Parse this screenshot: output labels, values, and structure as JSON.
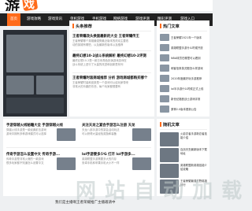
{
  "logo": {
    "text": "游",
    "badge": "戏"
  },
  "nav": [
    {
      "label": "首页",
      "active": true
    },
    {
      "label": "游戏攻略"
    },
    {
      "label": "游戏资讯"
    },
    {
      "label": "单机游戏"
    },
    {
      "label": "手机游戏"
    },
    {
      "label": "网络游戏"
    },
    {
      "label": "游戏评测"
    },
    {
      "label": "精彩评测"
    },
    {
      "label": "游戏入口"
    }
  ],
  "headlines": {
    "title": "头条推荐",
    "articles": [
      {
        "title": "王者荣耀改头换面最新的大全 王者荣耀传王",
        "summary": "王者荣耀哪个英雄最强势最近版本的改动主要改",
        "summary2": "动的英雄有哪些，以及最新的版本以及推荐",
        "meta": "2024-05-13"
      },
      {
        "title": "最终幻想10-2战斗系统解析 最终幻想10-2评测",
        "summary": "最终幻想10-2是一款日系角色扮演游戏游戏在",
        "summary2": "战斗系统上进行了大量的改进和创新是系列",
        "meta": "2024-05-13"
      },
      {
        "title": "王者荣耀时装商城推荐 分析 游戏商城都购买哪个",
        "summary": "王者荣耀时装和皮肤是一个游戏可以给玩家带来",
        "summary2": "非常大的乐趣的东西，每个玩家都想要有",
        "meta": "2024-05-13"
      }
    ]
  },
  "hot": {
    "title": "热门文章",
    "items": [
      {
        "title": "王者荣耀2021年一个版本"
      },
      {
        "title": "英雄联盟手游什么时候开放"
      },
      {
        "title": "NBA球员在哪里可以看到"
      },
      {
        "title": "刺客信条英灵殿怎么样游戏"
      },
      {
        "title": "2020年度最好玩手游推荐"
      },
      {
        "title": "lol半手游什么时候正式上线"
      },
      {
        "title": "新世纪福音战士游戏评测"
      },
      {
        "title": "原神2.0版本更新公告"
      }
    ]
  },
  "random": {
    "title": "随机文章",
    "items": [
      {
        "title": "火影忍者手游新忍者技能介绍"
      },
      {
        "title": "百战天虫最新版本下载地址"
      },
      {
        "title": "英雄联盟新英雄技能介绍攻略"
      },
      {
        "title": "王者荣耀最强打野英雄排行"
      }
    ]
  },
  "list": [
    {
      "title": "手游穿越火线秘籍大全 手游穿越火线",
      "summary": "穿越火线手游是一款经典射击游戏",
      "summary2": "游戏中拥有多种游戏模式可以选择"
    },
    {
      "title": "关注天龙之宴会手游怎么注册 天龙",
      "summary": "天龙八部手游中的宴会活动玩法",
      "summary2": "可以获得大量经验奖励和装备"
    },
    {
      "title": "传奇手游怎么设置中文 传奇手游...",
      "summary": "传奇手游是非常火爆的一款游戏",
      "summary2": "很多玩家都不知道怎么设置中文"
    },
    {
      "title": "lol手游要多少G 打开 lol手游多...",
      "summary": "英雄联盟手游需要多大的内存",
      "summary2": "安卓手机和苹果手机大小不一样"
    }
  ],
  "watermark": "网 站 自 动 加 载",
  "bottom_ad": "我们是主播啊王者荣耀推广主播邀请中"
}
